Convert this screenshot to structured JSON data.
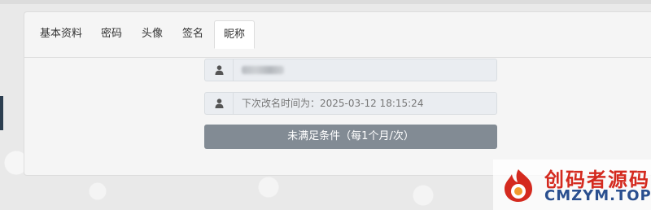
{
  "tabs": [
    {
      "label": "基本资料",
      "active": false
    },
    {
      "label": "密码",
      "active": false
    },
    {
      "label": "头像",
      "active": false
    },
    {
      "label": "签名",
      "active": false
    },
    {
      "label": "昵称",
      "active": true
    }
  ],
  "nickname_field": {
    "icon": "user-icon",
    "value_state": "blurred"
  },
  "next_rename": {
    "icon": "user-icon",
    "text": "下次改名时间为：2025-03-12 18:15:24"
  },
  "submit": {
    "label": "未满足条件（每1个月/次）",
    "color": "#828b94"
  },
  "watermark": {
    "cn": "创码者源码",
    "en": "CMZYM.TOP",
    "cn_color": "#d42a1f",
    "en_color": "#2a4f8f"
  }
}
